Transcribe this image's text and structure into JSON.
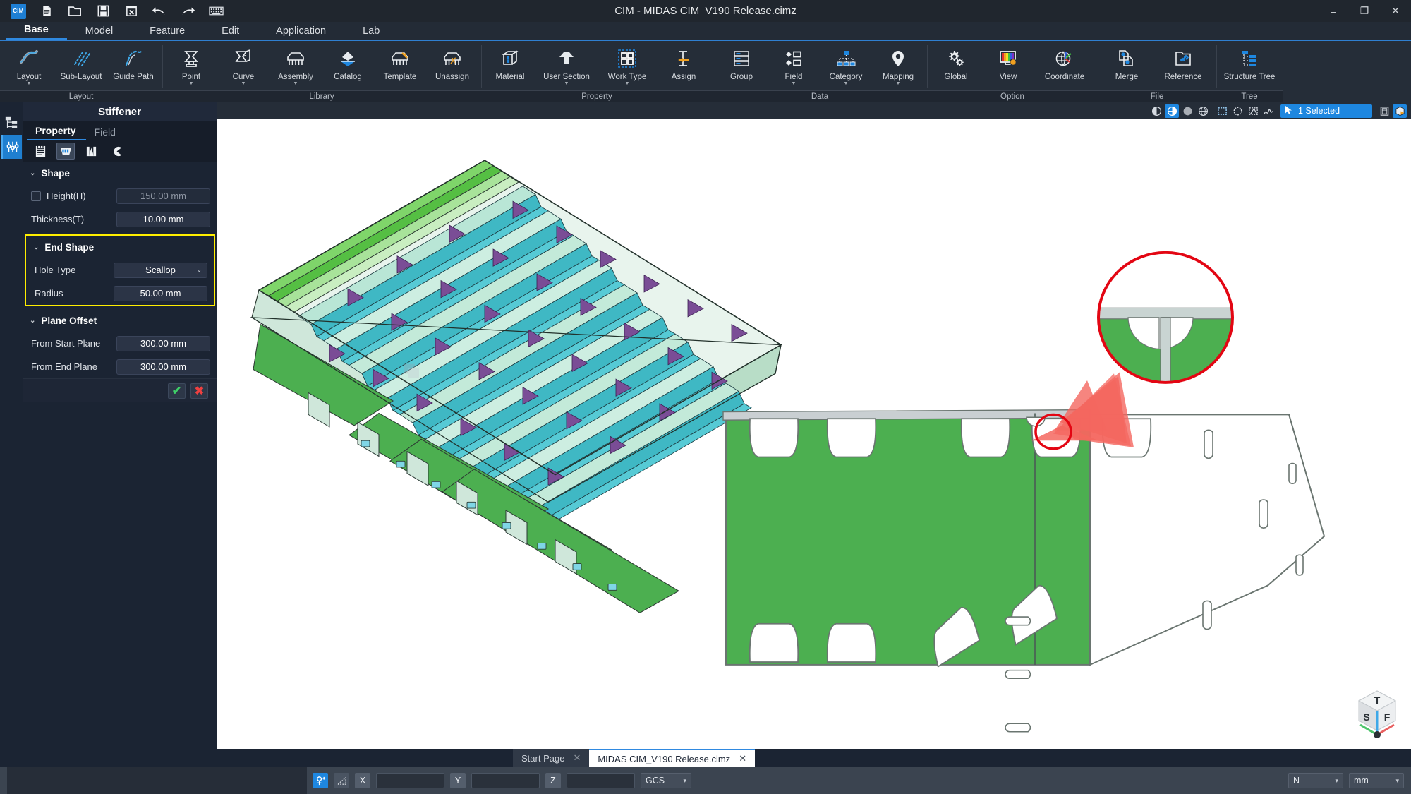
{
  "window": {
    "title": "CIM - MIDAS CIM_V190 Release.cimz",
    "app_badge": "CIM",
    "minimize": "–",
    "maximize": "❐",
    "close": "✕"
  },
  "quick_access": [
    {
      "name": "new-file-icon",
      "glyph": "🗎"
    },
    {
      "name": "open-folder-icon",
      "glyph": "📂"
    },
    {
      "name": "save-icon",
      "glyph": "💾"
    },
    {
      "name": "export-icon",
      "glyph": "⌧"
    },
    {
      "name": "undo-icon",
      "glyph": "↶"
    },
    {
      "name": "redo-icon",
      "glyph": "↷"
    },
    {
      "name": "keyboard-icon",
      "glyph": "⌨"
    }
  ],
  "menu_tabs": [
    {
      "label": "Base",
      "active": true
    },
    {
      "label": "Model",
      "active": false
    },
    {
      "label": "Feature",
      "active": false
    },
    {
      "label": "Edit",
      "active": false
    },
    {
      "label": "Application",
      "active": false
    },
    {
      "label": "Lab",
      "active": false
    }
  ],
  "ribbon": [
    {
      "group": "Layout",
      "items": [
        {
          "label": "Layout",
          "icon": "layout-icon",
          "caret": true
        },
        {
          "label": "Sub-Layout",
          "icon": "sub-layout-icon",
          "caret": false
        },
        {
          "label": "Guide Path",
          "icon": "guide-path-icon",
          "caret": false
        }
      ]
    },
    {
      "group": "Library",
      "items": [
        {
          "label": "Point",
          "icon": "point-icon",
          "caret": true
        },
        {
          "label": "Curve",
          "icon": "curve-icon",
          "caret": true
        },
        {
          "label": "Assembly",
          "icon": "assembly-icon",
          "caret": true
        },
        {
          "label": "Catalog",
          "icon": "catalog-icon",
          "caret": false
        },
        {
          "label": "Template",
          "icon": "template-icon",
          "caret": false
        },
        {
          "label": "Unassign",
          "icon": "unassign-icon",
          "caret": false
        }
      ]
    },
    {
      "group": "Property",
      "items": [
        {
          "label": "Material",
          "icon": "material-icon",
          "caret": false
        },
        {
          "label": "User Section",
          "icon": "user-section-icon",
          "caret": true
        },
        {
          "label": "Work Type",
          "icon": "work-type-icon",
          "caret": true
        },
        {
          "label": "Assign",
          "icon": "assign-icon",
          "caret": false
        }
      ]
    },
    {
      "group": "Data",
      "items": [
        {
          "label": "Group",
          "icon": "group-icon",
          "caret": false
        },
        {
          "label": "Field",
          "icon": "field-icon",
          "caret": true
        },
        {
          "label": "Category",
          "icon": "category-icon",
          "caret": true
        },
        {
          "label": "Mapping",
          "icon": "mapping-icon",
          "caret": true
        }
      ]
    },
    {
      "group": "Option",
      "items": [
        {
          "label": "Global",
          "icon": "global-gears-icon",
          "caret": false
        },
        {
          "label": "View",
          "icon": "view-monitor-icon",
          "caret": false
        },
        {
          "label": "Coordinate",
          "icon": "coordinate-globe-icon",
          "caret": false
        }
      ]
    },
    {
      "group": "File",
      "items": [
        {
          "label": "Merge",
          "icon": "merge-icon",
          "caret": false
        },
        {
          "label": "Reference",
          "icon": "reference-icon",
          "caret": false
        }
      ]
    },
    {
      "group": "Tree",
      "items": [
        {
          "label": "Structure Tree",
          "icon": "structure-tree-icon",
          "caret": false
        }
      ]
    }
  ],
  "rail": [
    {
      "name": "structure-tree-rail-icon",
      "selected": false
    },
    {
      "name": "property-sliders-rail-icon",
      "selected": true
    }
  ],
  "panel": {
    "title": "Stiffener",
    "tabs": [
      {
        "label": "Property",
        "active": true
      },
      {
        "label": "Field",
        "active": false
      }
    ],
    "iconbar": [
      {
        "name": "list-properties-icon",
        "selected": false
      },
      {
        "name": "stiffener-section-icon",
        "selected": true
      },
      {
        "name": "end-shape-icon",
        "selected": false
      },
      {
        "name": "scallop-cut-icon",
        "selected": false
      }
    ],
    "sections": [
      {
        "title": "Shape",
        "highlighted": false,
        "rows": [
          {
            "label": "Height(H)",
            "value": "150.00 mm",
            "checkbox": true,
            "checked": false,
            "disabled": true,
            "combo": false
          },
          {
            "label": "Thickness(T)",
            "value": "10.00 mm",
            "checkbox": false,
            "checked": false,
            "disabled": false,
            "combo": false
          }
        ]
      },
      {
        "title": "End Shape",
        "highlighted": true,
        "rows": [
          {
            "label": "Hole Type",
            "value": "Scallop",
            "checkbox": false,
            "checked": false,
            "disabled": false,
            "combo": true
          },
          {
            "label": "Radius",
            "value": "50.00 mm",
            "checkbox": false,
            "checked": false,
            "disabled": false,
            "combo": false
          }
        ]
      },
      {
        "title": "Plane Offset",
        "highlighted": false,
        "rows": [
          {
            "label": "From Start Plane",
            "value": "300.00 mm",
            "checkbox": false,
            "checked": false,
            "disabled": false,
            "combo": false
          },
          {
            "label": "From End Plane",
            "value": "300.00 mm",
            "checkbox": false,
            "checked": false,
            "disabled": false,
            "combo": false
          }
        ]
      }
    ],
    "ok_label": "✔",
    "cancel_label": "✖"
  },
  "view_toolbar": {
    "render_modes": [
      {
        "name": "shaded-edges-mode-icon",
        "on": false
      },
      {
        "name": "shaded-mode-icon",
        "on": true
      },
      {
        "name": "flat-mode-icon",
        "on": false
      },
      {
        "name": "wireframe-mode-icon",
        "on": false
      }
    ],
    "select_modes": [
      {
        "name": "rectangle-select-icon",
        "on": false
      },
      {
        "name": "circle-select-icon",
        "on": false
      },
      {
        "name": "polygon-select-icon",
        "on": false
      },
      {
        "name": "freehand-select-icon",
        "on": false
      }
    ],
    "selection_label": "1 Selected",
    "selection_cursor_icon": "arrow-cursor-icon",
    "extra": [
      {
        "name": "table-view-icon",
        "on": false
      },
      {
        "name": "isolate-box-icon",
        "on": true
      }
    ]
  },
  "viewcube": {
    "top_face": "T",
    "left_face": "S",
    "right_face": "F"
  },
  "doc_tabs": [
    {
      "label": "Start Page",
      "active": false,
      "close": "✕"
    },
    {
      "label": "MIDAS CIM_V190 Release.cimz",
      "active": true,
      "close": "✕"
    }
  ],
  "statusbar": {
    "snap_icon": "snap-point-icon",
    "ortho_icon": "angle-snap-icon",
    "coords": [
      {
        "axis": "X",
        "value": ""
      },
      {
        "axis": "Y",
        "value": ""
      },
      {
        "axis": "Z",
        "value": ""
      }
    ],
    "csys": "GCS",
    "force_unit": "N",
    "length_unit": "mm",
    "caret": "▾"
  },
  "colors": {
    "accent": "#1e87e0",
    "highlight": "#ffee00",
    "ok": "#3fd068",
    "cancel": "#ef4040",
    "plate_green": "#4caf50",
    "callout_red": "#e30613",
    "arrow_blue": "#4472c4",
    "deck_teal": "#2fb3bf",
    "panel_bg": "#1b2433"
  }
}
